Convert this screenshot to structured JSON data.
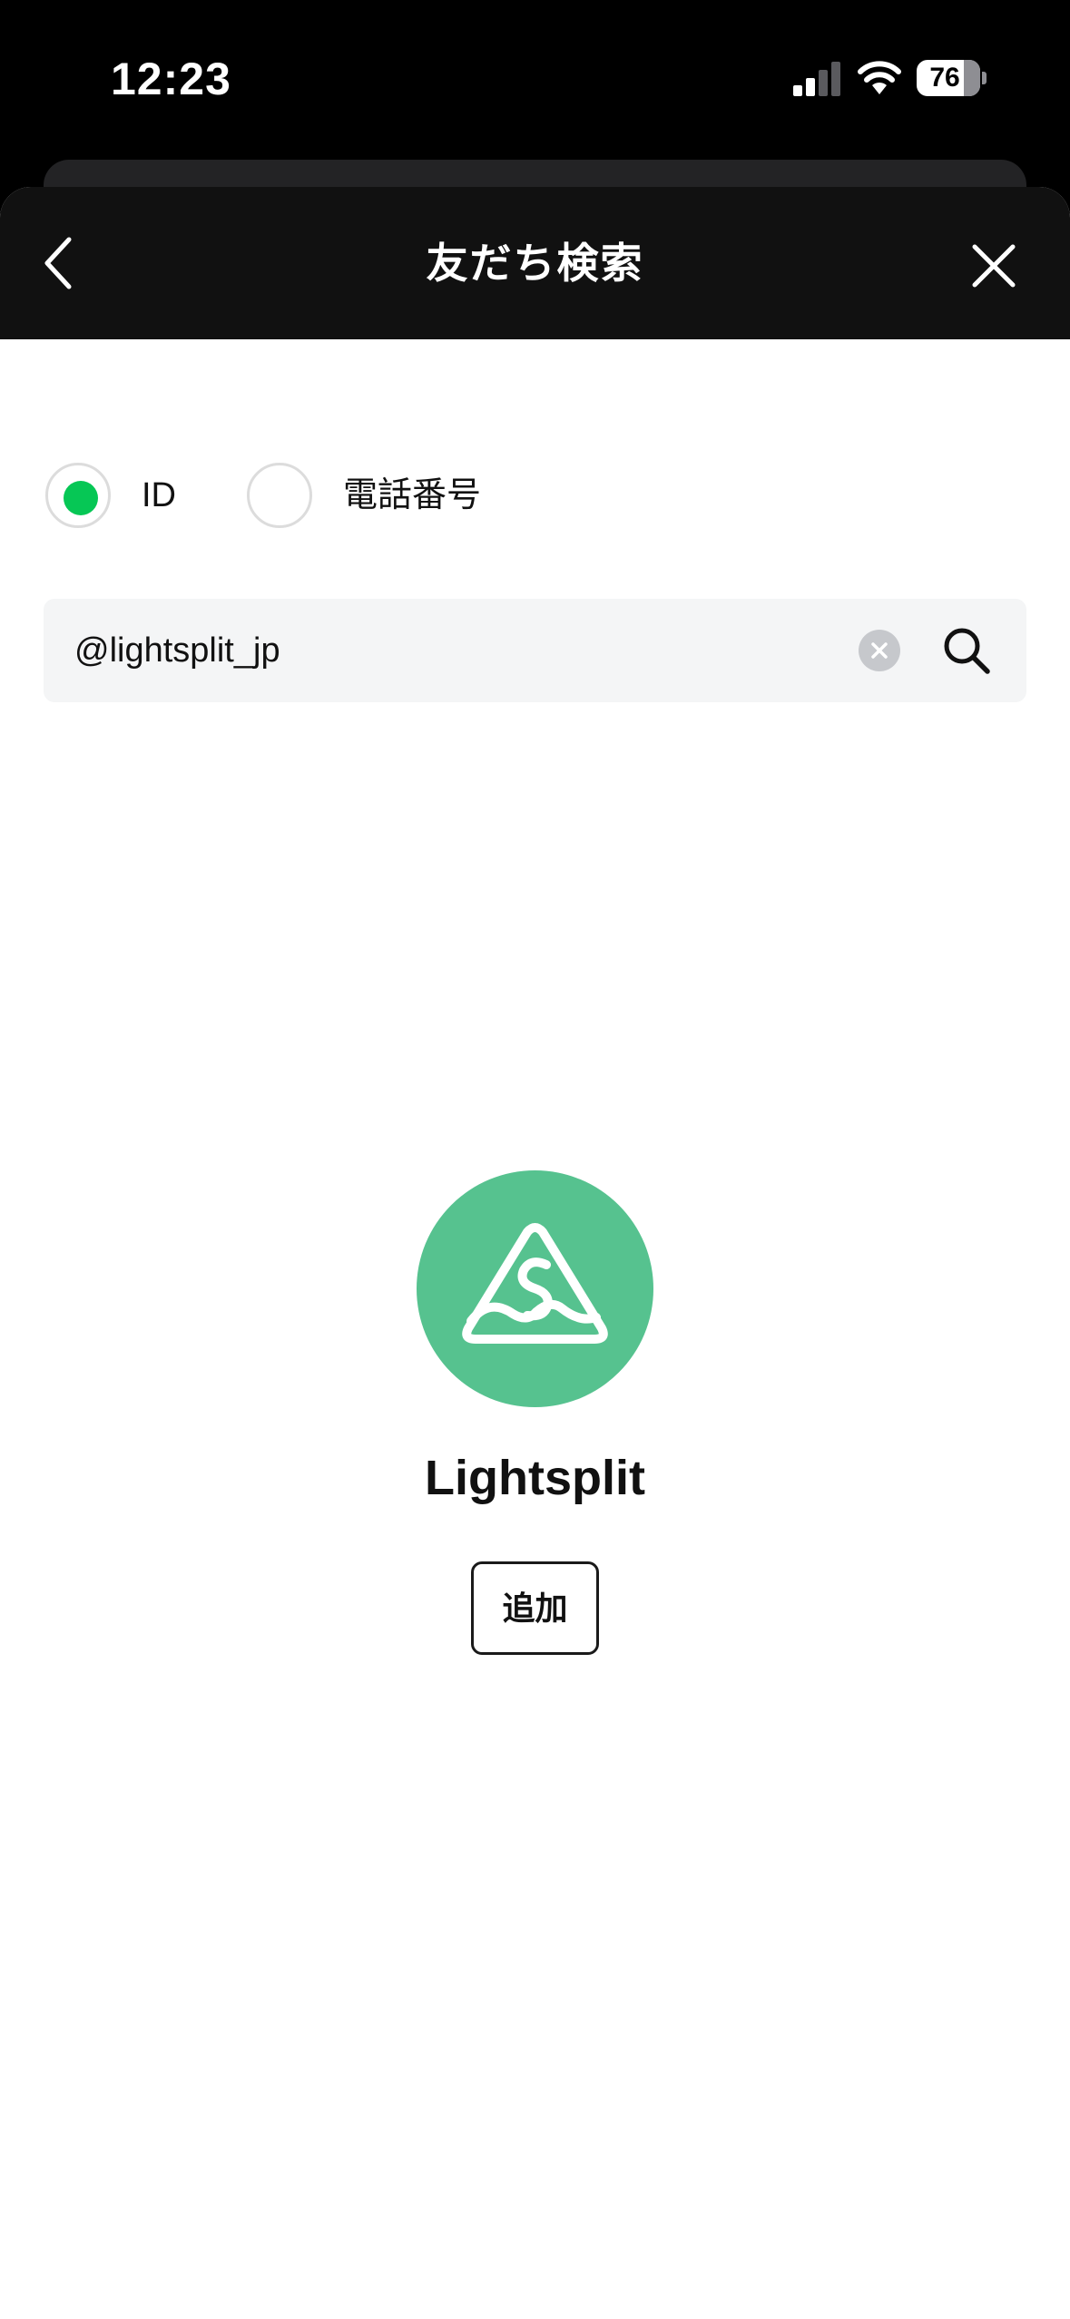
{
  "status_bar": {
    "time": "12:23",
    "battery_level": "76",
    "icons": [
      "signal-icon",
      "wifi-icon",
      "battery-icon"
    ]
  },
  "nav": {
    "title": "友だち検索",
    "back_icon": "chevron-left-icon",
    "close_icon": "close-icon"
  },
  "search_type": {
    "options": [
      {
        "label": "ID",
        "selected": true
      },
      {
        "label": "電話番号",
        "selected": false
      }
    ]
  },
  "search": {
    "value": "@lightsplit_jp",
    "clear_icon": "clear-icon",
    "search_icon": "search-icon"
  },
  "result": {
    "name": "Lightsplit",
    "add_label": "追加",
    "avatar_icon": "lightsplit-logo"
  },
  "colors": {
    "accent_green": "#06c755",
    "avatar_bg": "#56c28f",
    "nav_bg": "#111111",
    "search_bg": "#f4f5f6"
  }
}
